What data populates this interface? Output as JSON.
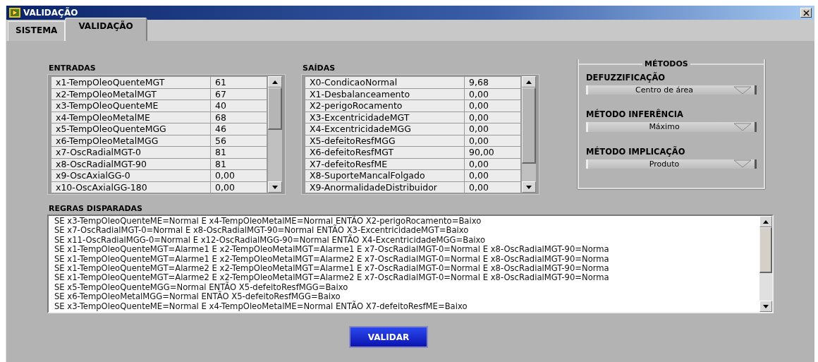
{
  "window": {
    "title": "VALIDAÇÃO"
  },
  "tabs": [
    {
      "label": "SISTEMA",
      "selected": false
    },
    {
      "label": "VALIDAÇÃO",
      "selected": true
    }
  ],
  "entradas": {
    "label": "ENTRADAS",
    "rows": [
      {
        "name": "x1-TempOleoQuenteMGT",
        "value": "61"
      },
      {
        "name": "x2-TempOleoMetalMGT",
        "value": "67"
      },
      {
        "name": "x3-TempOleoQuenteME",
        "value": "40"
      },
      {
        "name": "x4-TempOleoMetalME",
        "value": "68"
      },
      {
        "name": "x5-TempOleoQuenteMGG",
        "value": "46"
      },
      {
        "name": "x6-TempOleoMetalMGG",
        "value": "56"
      },
      {
        "name": "x7-OscRadialMGT-0",
        "value": "81"
      },
      {
        "name": "x8-OscRadialMGT-90",
        "value": "81"
      },
      {
        "name": "x9-OscAxialGG-0",
        "value": "0,00"
      },
      {
        "name": "x10-OscAxialGG-180",
        "value": "0,00"
      }
    ]
  },
  "saidas": {
    "label": "SAÍDAS",
    "rows": [
      {
        "name": "X0-CondicaoNormal",
        "value": "9,68"
      },
      {
        "name": "X1-Desbalanceamento",
        "value": "0,00"
      },
      {
        "name": "X2-perigoRocamento",
        "value": "0,00"
      },
      {
        "name": "X3-ExcentricidadeMGT",
        "value": "0,00"
      },
      {
        "name": "X4-ExcentricidadeMGG",
        "value": "0,00"
      },
      {
        "name": "X5-defeitoResfMGG",
        "value": "0,00"
      },
      {
        "name": "X6-defeitoResfMGT",
        "value": "90,00"
      },
      {
        "name": "X7-defeitoResfME",
        "value": "0,00"
      },
      {
        "name": "X8-SuporteMancalFolgado",
        "value": "0,00"
      },
      {
        "name": "X9-AnormalidadeDistribuidor",
        "value": "0,00"
      }
    ]
  },
  "metodos": {
    "title": "MÉTODOS",
    "fields": [
      {
        "label": "DEFUZZIFICAÇÃO",
        "value": "Centro de área"
      },
      {
        "label": "MÉTODO INFERÊNCIA",
        "value": "Máximo"
      },
      {
        "label": "MÉTODO IMPLICAÇÃO",
        "value": "Produto"
      }
    ]
  },
  "regras": {
    "label": "REGRAS DISPARADAS",
    "lines": [
      "SE x3-TempOleoQuenteME=Normal E x4-TempOleoMetalME=Normal ENTÃO X2-perigoRocamento=Baixo",
      "SE x7-OscRadialMGT-0=Normal E x8-OscRadialMGT-90=Normal ENTÃO X3-ExcentricidadeMGT=Baixo",
      "SE x11-OscRadialMGG-0=Normal E x12-OscRadialMGG-90=Normal ENTÃO X4-ExcentricidadeMGG=Baixo",
      "SE x1-TempOleoQuenteMGT=Alarme1 E x2-TempOleoMetalMGT=Alarme1 E x7-OscRadialMGT-0=Normal E x8-OscRadialMGT-90=Norma",
      "SE x1-TempOleoQuenteMGT=Alarme1 E x2-TempOleoMetalMGT=Alarme2 E x7-OscRadialMGT-0=Normal E x8-OscRadialMGT-90=Norma",
      "SE x1-TempOleoQuenteMGT=Alarme2 E x2-TempOleoMetalMGT=Alarme1 E x7-OscRadialMGT-0=Normal E x8-OscRadialMGT-90=Norma",
      "SE x1-TempOleoQuenteMGT=Alarme2 E x2-TempOleoMetalMGT=Alarme2 E x7-OscRadialMGT-0=Normal E x8-OscRadialMGT-90=Norma",
      "SE x5-TempOleoQuenteMGG=Normal ENTÃO X5-defeitoResfMGG=Baixo",
      "SE x6-TempOleoMetalMGG=Normal ENTÃO X5-defeitoResfMGG=Baixo",
      "SE x3-TempOleoQuenteME=Normal E x4-TempOleoMetalME=Normal ENTÃO X7-defeitoResfME=Baixo"
    ]
  },
  "button": {
    "label": "VALIDAR"
  }
}
